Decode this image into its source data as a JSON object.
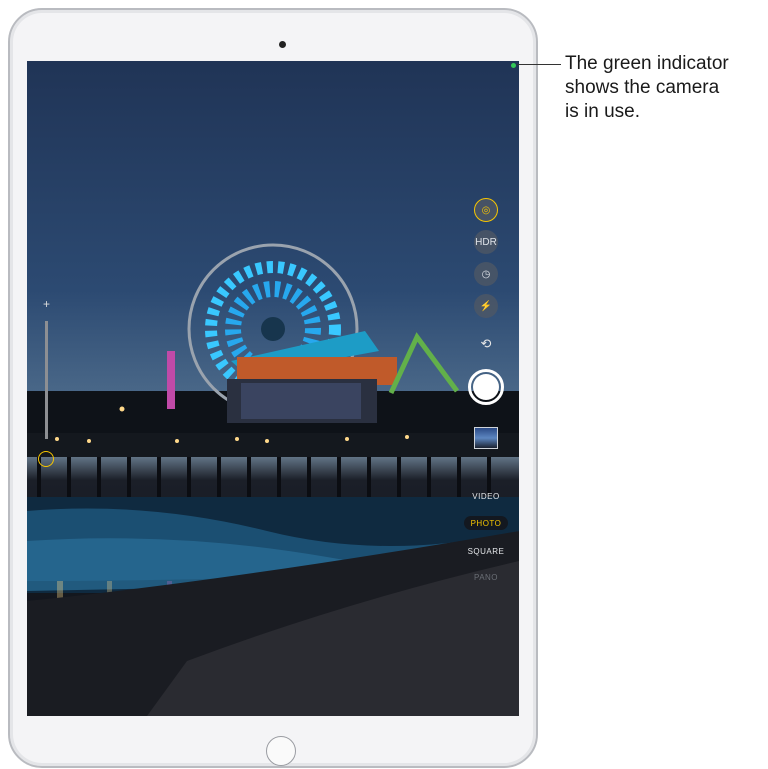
{
  "callout": {
    "text_line1": "The green indicator",
    "text_line2": "shows the camera",
    "text_line3": "is in use."
  },
  "camera": {
    "zoom_plus": "+",
    "controls": {
      "live_icon": "live-photo-icon",
      "hdr_label": "HDR",
      "timer_icon": "timer-icon",
      "flash_icon": "flash-icon",
      "flip_icon": "camera-flip-icon"
    },
    "modes": [
      "VIDEO",
      "PHOTO",
      "SQUARE",
      "PANO"
    ],
    "active_mode": "PHOTO"
  },
  "colors": {
    "indicator": "#34c759",
    "accent": "#f7c600"
  }
}
